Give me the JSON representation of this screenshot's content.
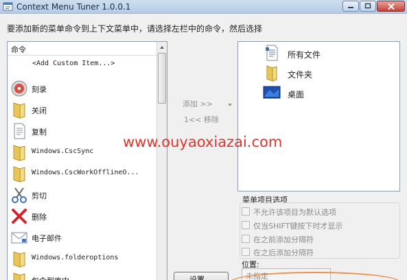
{
  "window": {
    "title": "Context Menu Tuner 1.0.0.1"
  },
  "instruction": "要添加新的菜单命令到上下文菜单中，请选择左栏中的命令，然后选择",
  "commands": {
    "header": "命令",
    "items": [
      {
        "label": "<Add Custom Item...>",
        "icon": "none",
        "mono": true
      },
      {
        "label": "刻录",
        "icon": "disc-icon",
        "mono": false
      },
      {
        "label": "关闭",
        "icon": "folder-icon",
        "mono": false
      },
      {
        "label": "复制",
        "icon": "document-icon",
        "mono": false
      },
      {
        "label": "Windows.CscSync",
        "icon": "folder-icon",
        "mono": true
      },
      {
        "label": "Windows.CscWorkOfflineO...",
        "icon": "folder-icon",
        "mono": true
      },
      {
        "label": "剪切",
        "icon": "scissors-icon",
        "mono": false
      },
      {
        "label": "删除",
        "icon": "delete-x-icon",
        "mono": false
      },
      {
        "label": "电子邮件",
        "icon": "email-icon",
        "mono": false
      },
      {
        "label": "Windows.folderoptions",
        "icon": "folder-icon",
        "mono": true
      },
      {
        "label": "包含到库中",
        "icon": "folder-icon",
        "mono": false
      }
    ]
  },
  "middle": {
    "add": "添加 >>",
    "remove": "1<< 移除"
  },
  "targets": [
    {
      "label": "所有文件",
      "icon": "file-icon"
    },
    {
      "label": "文件夹",
      "icon": "folder-icon"
    },
    {
      "label": "桌面",
      "icon": "desktop-icon"
    }
  ],
  "options": {
    "title": "菜单项目选项",
    "items": [
      "不允许该项目为默认选项",
      "仅当SHIFT键按下时才显示",
      "在之前添加分隔符",
      "在之后添加分隔符"
    ],
    "position_label": "位置:",
    "position_value": "未指定"
  },
  "settings_button": "设置...",
  "watermark": "www.ouyaoxiazai.com",
  "colors": {
    "watermark": "#e2332d",
    "highlight": "#ef8f4a",
    "titlebar": "#b6cbe4"
  }
}
